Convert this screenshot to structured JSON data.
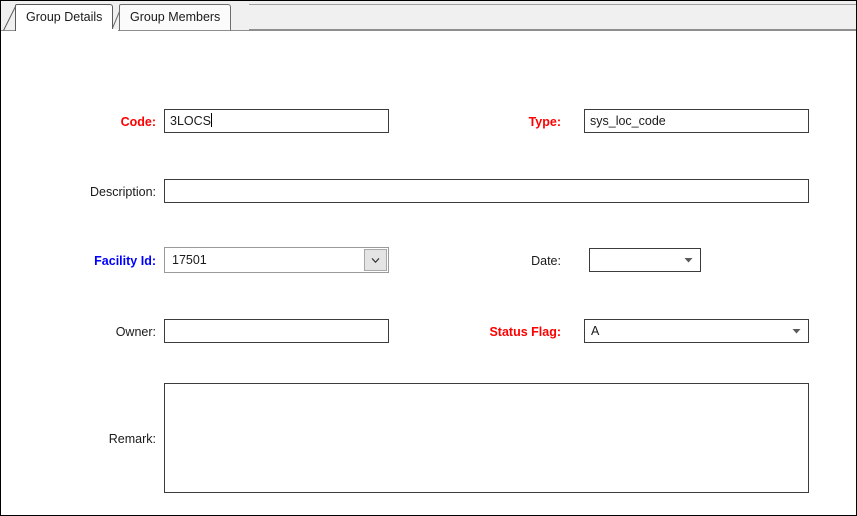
{
  "window": {
    "title": "Group Details"
  },
  "tabs": [
    {
      "label": "Group Details",
      "active": true
    },
    {
      "label": "Group Members",
      "active": false
    }
  ],
  "form": {
    "code": {
      "label": "Code:",
      "value": "3LOCS",
      "placeholder": "",
      "required": true,
      "label_color": "#ff0000",
      "focused": true
    },
    "type": {
      "label": "Type:",
      "value": "sys_loc_code",
      "required": true,
      "label_color": "#ff0000",
      "readonly": true
    },
    "description": {
      "label": "Description:",
      "value": "",
      "placeholder": "",
      "label_color": "#1a1a1a"
    },
    "facility_id": {
      "label": "Facility Id:",
      "value": "17501",
      "label_color": "#0000ff",
      "control": "combobox",
      "icon": "chevron-down-icon"
    },
    "date": {
      "label": "Date:",
      "value": "",
      "label_color": "#1a1a1a",
      "control": "dropdown",
      "icon": "triangle-down-icon"
    },
    "owner": {
      "label": "Owner:",
      "value": "",
      "placeholder": "",
      "label_color": "#1a1a1a"
    },
    "status_flag": {
      "label": "Status Flag:",
      "value": "A",
      "required": true,
      "label_color": "#ff0000",
      "control": "dropdown",
      "icon": "triangle-down-icon"
    },
    "remark": {
      "label": "Remark:",
      "value": "",
      "placeholder": "",
      "label_color": "#1a1a1a"
    }
  }
}
